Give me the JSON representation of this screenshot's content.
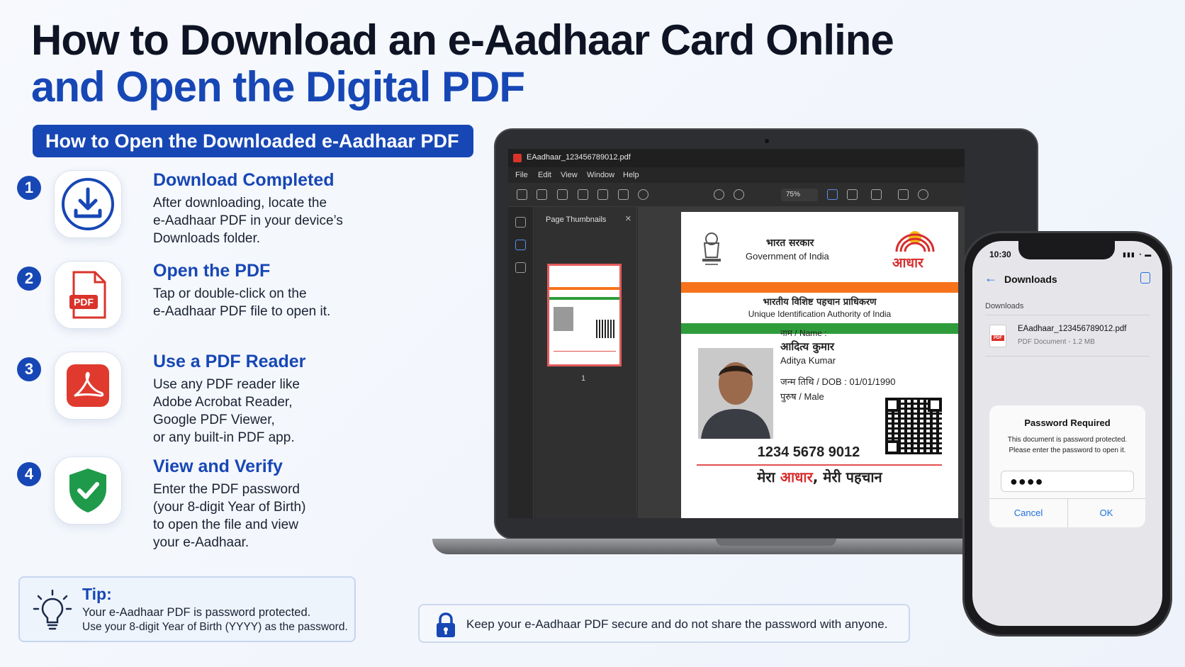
{
  "title": {
    "line1": "How to Download an e-Aadhaar Card Online",
    "line2": "and Open the Digital PDF"
  },
  "section_pill": "How to Open the Downloaded e-Aadhaar PDF",
  "steps": [
    {
      "num": "1",
      "icon": "download-icon",
      "title": "Download Completed",
      "desc": [
        "After downloading, locate the",
        "e-Aadhaar PDF in your device’s",
        "Downloads folder."
      ]
    },
    {
      "num": "2",
      "icon": "pdf-file-icon",
      "title": "Open the PDF",
      "desc": [
        "Tap or double-click on the",
        "e-Aadhaar PDF file to open it."
      ],
      "icon_label": "PDF"
    },
    {
      "num": "3",
      "icon": "acrobat-icon",
      "title": "Use a PDF Reader",
      "desc": [
        "Use any PDF reader like",
        "Adobe Acrobat Reader,",
        "Google PDF Viewer,",
        "or any built-in PDF app."
      ]
    },
    {
      "num": "4",
      "icon": "shield-check-icon",
      "title": "View and Verify",
      "desc": [
        "Enter the PDF password",
        "(your 8-digit Year of Birth)",
        "to open the file and view",
        "your e-Aadhaar."
      ]
    }
  ],
  "tip": {
    "label": "Tip:",
    "line1": "Your e-Aadhaar PDF is password protected.",
    "line2": "Use your 8-digit Year of Birth (YYYY) as the password."
  },
  "secure_note": "Keep your e-Aadhaar PDF secure and do not share the password with anyone.",
  "laptop": {
    "file_name": "EAadhaar_123456789012.pdf",
    "menu": [
      "File",
      "Edit",
      "View",
      "Window",
      "Help"
    ],
    "zoom": "75%",
    "panel_title": "Page Thumbnails",
    "close": "×",
    "page_number": "1"
  },
  "aadhaar": {
    "gov_hindi": "भारत सरकार",
    "gov_english": "Government of India",
    "logo_text": "आधार",
    "uid_hindi": "भारतीय विशिष्ट पहचान प्राधिकरण",
    "uid_english": "Unique Identification Authority of India",
    "name_label": "नाम / Name :",
    "name_hindi": "आदित्य कुमार",
    "name_english": "Aditya Kumar",
    "dob": "जन्म तिथि / DOB : 01/01/1990",
    "gender": "पुरुष / Male",
    "number": "1234 5678 9012",
    "tagline_pre": "मेरा ",
    "tagline_red": "आधार",
    "tagline_post": ", मेरी पहचान"
  },
  "phone": {
    "time": "10:30",
    "status": "▮▮▮ ◔ ▬",
    "back": "←",
    "nav_title": "Downloads",
    "section": "Downloads",
    "file_name": "EAadhaar_123456789012.pdf",
    "file_icon_label": "PDF",
    "file_meta": "PDF Document - 1.2 MB",
    "dialog": {
      "title": "Password Required",
      "line1": "This document is password protected.",
      "line2": "Please enter the password to open it.",
      "value": "●●●●",
      "cancel": "Cancel",
      "ok": "OK"
    }
  },
  "colors": {
    "primary": "#1747b5",
    "saffron": "#f6731c",
    "green": "#2f9c3c",
    "red": "#d62e2e",
    "ios_blue": "#1f6fe0"
  }
}
